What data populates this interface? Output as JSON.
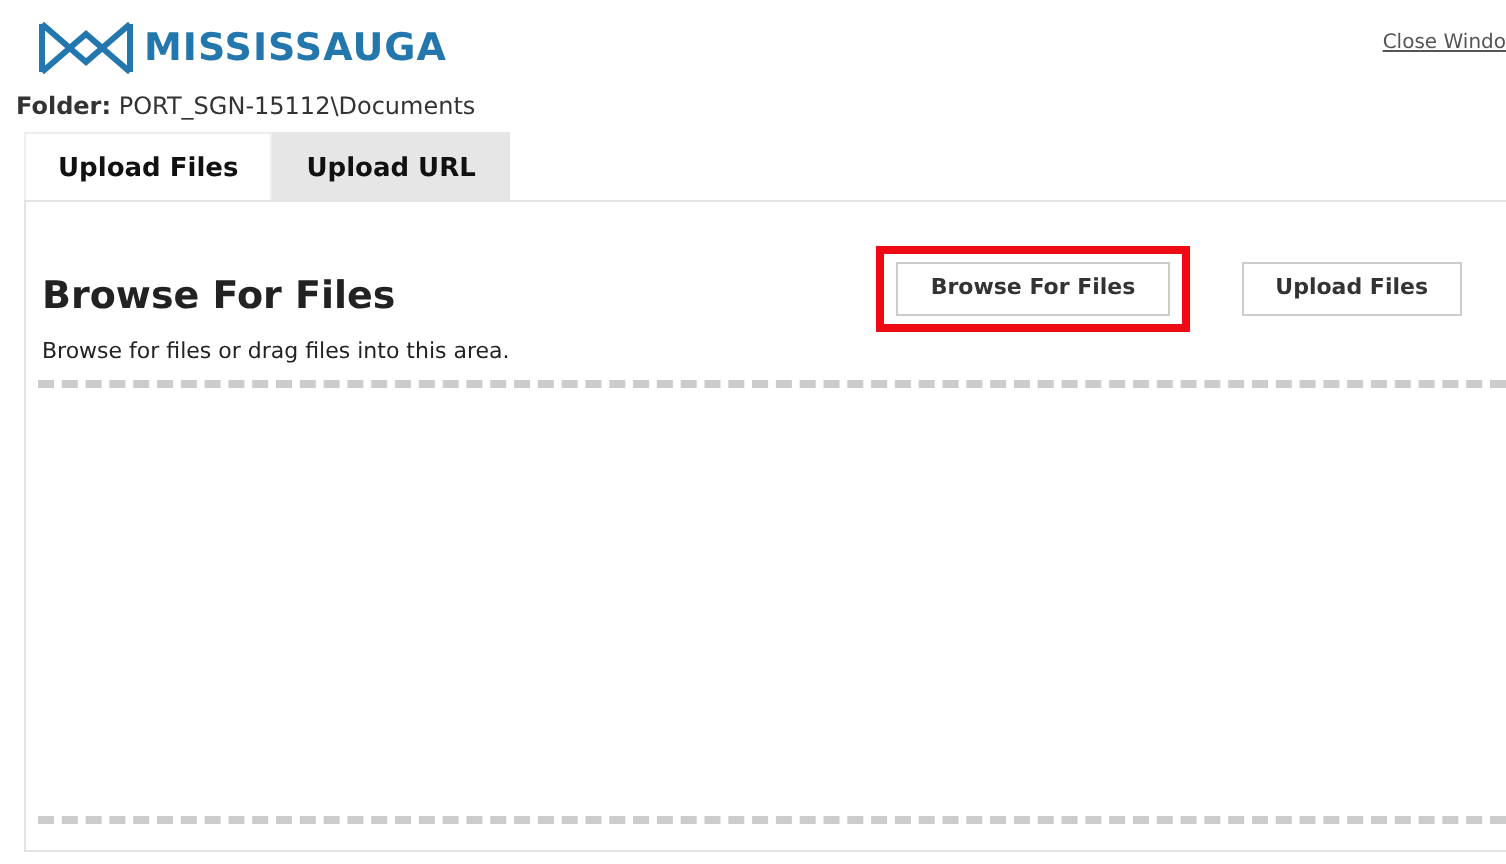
{
  "logo": {
    "text": "MISSISSAUGA"
  },
  "close_link": "Close Windo",
  "folder": {
    "label": "Folder:",
    "path": "PORT_SGN-15112\\Documents"
  },
  "tabs": [
    {
      "label": "Upload Files",
      "selected": true
    },
    {
      "label": "Upload URL",
      "selected": false
    }
  ],
  "panel": {
    "title": "Browse For Files",
    "hint": "Browse for files or drag files into this area.",
    "buttons": [
      {
        "label": "Browse For Files",
        "highlighted": true
      },
      {
        "label": "Upload Files",
        "highlighted": false
      }
    ]
  }
}
